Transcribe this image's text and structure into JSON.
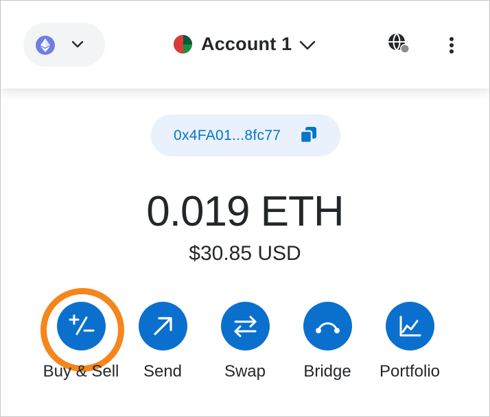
{
  "header": {
    "network_icon": "ethereum-icon",
    "account_name": "Account 1",
    "globe_icon": "globe-icon",
    "menu_icon": "kebab-menu-icon"
  },
  "address": {
    "short": "0x4FA01...8fc77",
    "copy_icon": "copy-icon"
  },
  "balance": {
    "amount": "0.019 ETH",
    "fiat": "$30.85 USD"
  },
  "actions": [
    {
      "label": "Buy & Sell",
      "icon": "plus-minus-icon",
      "highlighted": true
    },
    {
      "label": "Send",
      "icon": "arrow-up-right-icon"
    },
    {
      "label": "Swap",
      "icon": "swap-arrows-icon"
    },
    {
      "label": "Bridge",
      "icon": "bridge-icon"
    },
    {
      "label": "Portfolio",
      "icon": "chart-line-icon"
    }
  ],
  "colors": {
    "primary": "#0b70cd",
    "highlight": "#f6851b",
    "address_bg": "#e9f1fc",
    "address_text": "#0376c9",
    "text": "#24272a"
  }
}
